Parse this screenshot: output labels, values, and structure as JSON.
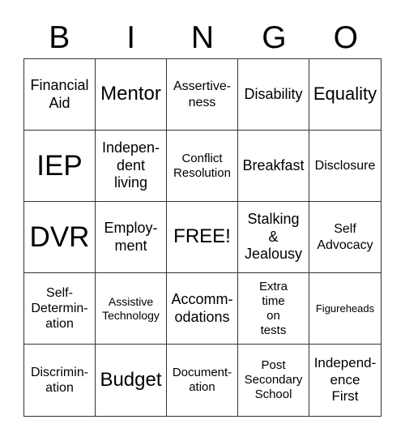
{
  "header": [
    "B",
    "I",
    "N",
    "G",
    "O"
  ],
  "cells": [
    "Financial\nAid",
    "Mentor",
    "Assertive-\nness",
    "Disability",
    "Equality",
    "IEP",
    "Indepen-\ndent\nliving",
    "Conflict\nResolution",
    "Breakfast",
    "Disclosure",
    "DVR",
    "Employ-\nment",
    "FREE!",
    "Stalking\n&\nJealousy",
    "Self\nAdvocacy",
    "Self-\nDetermin-\nation",
    "Assistive\nTechnology",
    "Accomm-\nodations",
    "Extra\ntime\non\ntests",
    "Figureheads",
    "Discrimin-\nation",
    "Budget",
    "Document-\nation",
    "Post\nSecondary\nSchool",
    "Independ-\nence\nFirst"
  ]
}
